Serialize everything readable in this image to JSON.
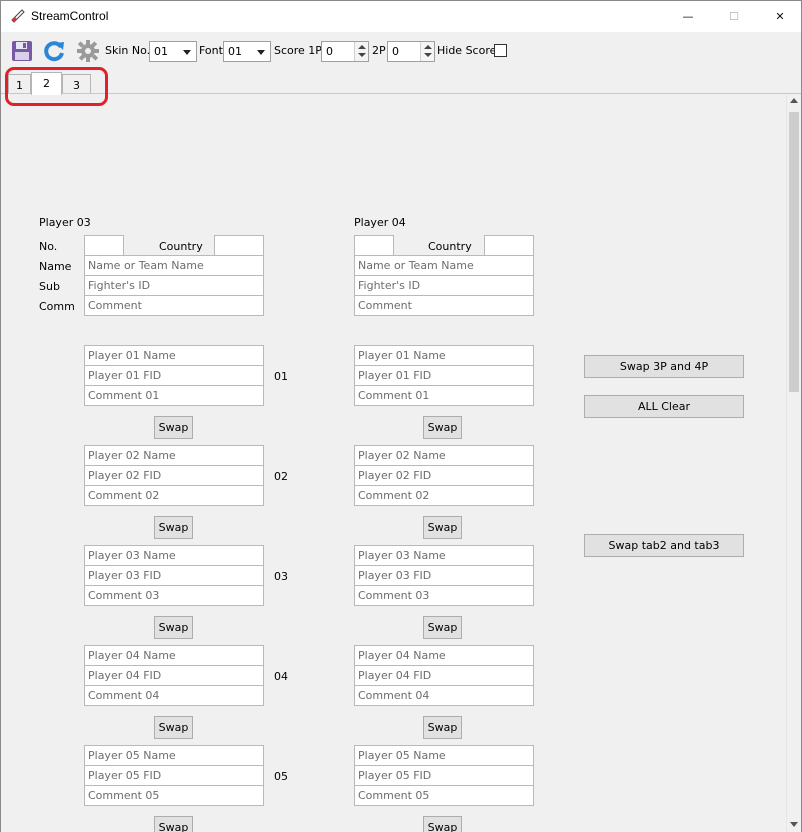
{
  "window": {
    "title": "StreamControl",
    "minimize": "—",
    "maximize": "☐",
    "close": "✕"
  },
  "toolbar": {
    "icons": [
      "save-icon",
      "refresh-icon",
      "settings-gear-icon"
    ],
    "skin_label": "Skin No.",
    "skin_value": "01",
    "font_label": "Font",
    "font_value": "01",
    "score_label": "Score 1P",
    "score_1p_value": "0",
    "score_2p_label": "2P",
    "score_2p_value": "0",
    "hide_score_label": "Hide Score"
  },
  "tabs": [
    {
      "label": "1",
      "active": false
    },
    {
      "label": "2",
      "active": true
    },
    {
      "label": "3",
      "active": false
    }
  ],
  "highlight_color": "#e0202a",
  "player3": {
    "heading": "Player 03",
    "no_label": "No.",
    "country_label": "Country",
    "name_label": "Name",
    "sub_label": "Sub",
    "comm_label": "Comm",
    "name_placeholder": "Name or Team Name",
    "sub_placeholder": "Fighter's ID",
    "comm_placeholder": "Comment"
  },
  "player4": {
    "heading": "Player 04",
    "country_label": "Country",
    "name_placeholder": "Name or Team Name",
    "sub_placeholder": "Fighter's ID",
    "comm_placeholder": "Comment"
  },
  "slots": [
    {
      "number": "01",
      "name": "Player 01 Name",
      "fid": "Player 01 FID",
      "comment": "Comment 01",
      "swap": "Swap"
    },
    {
      "number": "02",
      "name": "Player 02 Name",
      "fid": "Player 02 FID",
      "comment": "Comment 02",
      "swap": "Swap"
    },
    {
      "number": "03",
      "name": "Player 03 Name",
      "fid": "Player 03 FID",
      "comment": "Comment 03",
      "swap": "Swap"
    },
    {
      "number": "04",
      "name": "Player 04 Name",
      "fid": "Player 04 FID",
      "comment": "Comment 04",
      "swap": "Swap"
    },
    {
      "number": "05",
      "name": "Player 05 Name",
      "fid": "Player 05 FID",
      "comment": "Comment 05",
      "swap": "Swap"
    }
  ],
  "actions": {
    "swap_3p_4p": "Swap 3P and 4P",
    "all_clear": "ALL Clear",
    "swap_tabs": "Swap tab2 and tab3"
  }
}
